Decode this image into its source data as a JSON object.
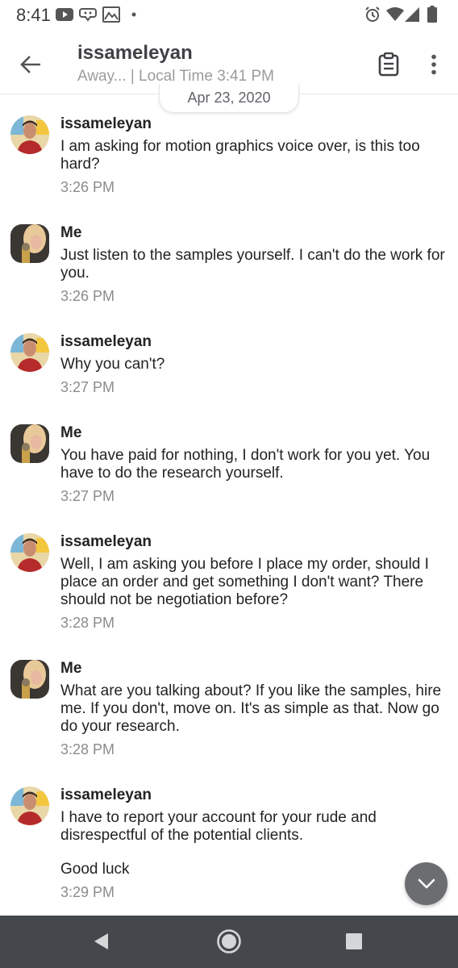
{
  "status_bar": {
    "time": "8:41"
  },
  "header": {
    "contact_name": "issameleyan",
    "contact_status": "Away... | Local Time 3:41 PM",
    "icons": [
      "back-arrow-icon",
      "clipboard-icon",
      "more-vertical-icon"
    ]
  },
  "date_chip": "Apr 23, 2020",
  "messages": [
    {
      "sender": "issameleyan",
      "texts": [
        "I am asking for motion graphics voice over, is this too hard?"
      ],
      "time": "3:26 PM"
    },
    {
      "sender": "Me",
      "texts": [
        "Just listen to the samples yourself. I can't do the work for you."
      ],
      "time": "3:26 PM"
    },
    {
      "sender": "issameleyan",
      "texts": [
        "Why you can't?"
      ],
      "time": "3:27 PM"
    },
    {
      "sender": "Me",
      "texts": [
        "You have paid for nothing, I don't work for you yet. You have to do the research yourself."
      ],
      "time": "3:27 PM"
    },
    {
      "sender": "issameleyan",
      "texts": [
        "Well, I am asking you before I place my order, should I place an order and get something I don't want? There should not be negotiation before?"
      ],
      "time": "3:28 PM"
    },
    {
      "sender": "Me",
      "texts": [
        "What are you talking about? If you like the samples, hire me. If you don't, move on. It's as simple as that. Now go do your research."
      ],
      "time": "3:28 PM"
    },
    {
      "sender": "issameleyan",
      "texts": [
        "I have to report your account for your rude and disrespectful of the potential clients.",
        "Good luck"
      ],
      "time": "3:29 PM"
    }
  ],
  "colors": {
    "nav_bar": "#44484d",
    "fab": "#6c6d70",
    "secondary_text": "#8b8c8f"
  }
}
